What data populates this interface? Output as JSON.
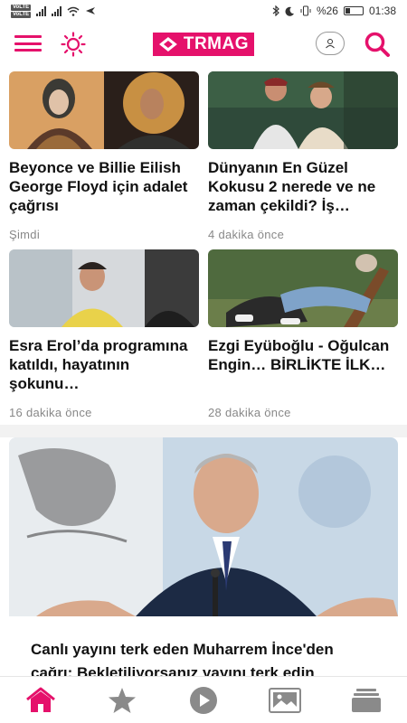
{
  "status_bar": {
    "volte_1": "VoLTE",
    "volte_2": "VoLTE",
    "battery": "%26",
    "time": "01:38"
  },
  "header": {
    "logo_text": "TRMAG"
  },
  "articles": [
    {
      "title": "Beyonce ve Billie Eilish George Floyd için adalet çağrısı",
      "time": "Şimdi"
    },
    {
      "title": "Dünyanın En Güzel Kokusu 2 nerede ve ne zaman çekildi? İş…",
      "time": "4 dakika önce"
    },
    {
      "title": "Esra Erol’da programına katıldı, hayatının şokunu…",
      "time": "16 dakika önce"
    },
    {
      "title": "Ezgi Eyüboğlu - Oğulcan Engin… BİRLİKTE İLK…",
      "time": "28 dakika önce"
    }
  ],
  "featured": {
    "title": "Canlı yayını terk eden Muharrem İnce'den çağrı: Bekletiliyorsanız yayını terk edin"
  },
  "colors": {
    "accent": "#e5116b",
    "nav_inactive": "#8a8a8a"
  },
  "icons": [
    "menu-icon",
    "sun-icon",
    "user-icon",
    "search-icon",
    "home-icon",
    "star-icon",
    "play-icon",
    "gallery-icon",
    "stack-icon"
  ]
}
